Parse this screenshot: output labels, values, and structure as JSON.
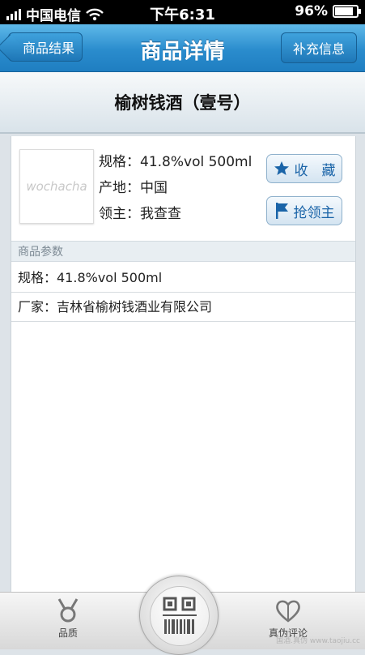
{
  "status_bar": {
    "carrier": "中国电信",
    "time": "下午6:31",
    "battery": "96%"
  },
  "nav": {
    "back_label": "商品结果",
    "title": "商品详情",
    "right_label": "补充信息"
  },
  "product": {
    "name": "榆树钱酒（壹号）",
    "thumb_logo": "wochacha",
    "spec_line": "规格：41.8%vol 500ml",
    "origin_line": "产地：中国",
    "owner_line": "领主：我查查"
  },
  "actions": {
    "favorite": "收　藏",
    "claim": "抢领主"
  },
  "params": {
    "header": "商品参数",
    "rows": [
      "规格：41.8%vol 500ml",
      "厂家：吉林省榆树钱酒业有限公司"
    ]
  },
  "tabbar": {
    "left_label": "品质",
    "right_label": "真伪评论"
  },
  "watermark": "国酒.真伪 www.taojiu.cc",
  "colors": {
    "nav_blue": "#2a8ccd",
    "action_blue": "#1a64a8"
  },
  "icons": {
    "signal": "signal-bars-icon",
    "wifi": "wifi-icon",
    "battery": "battery-icon",
    "star": "star-icon",
    "flag": "flag-icon",
    "medal": "medal-icon",
    "scan": "barcode-scan-icon",
    "heart": "heart-icon"
  }
}
